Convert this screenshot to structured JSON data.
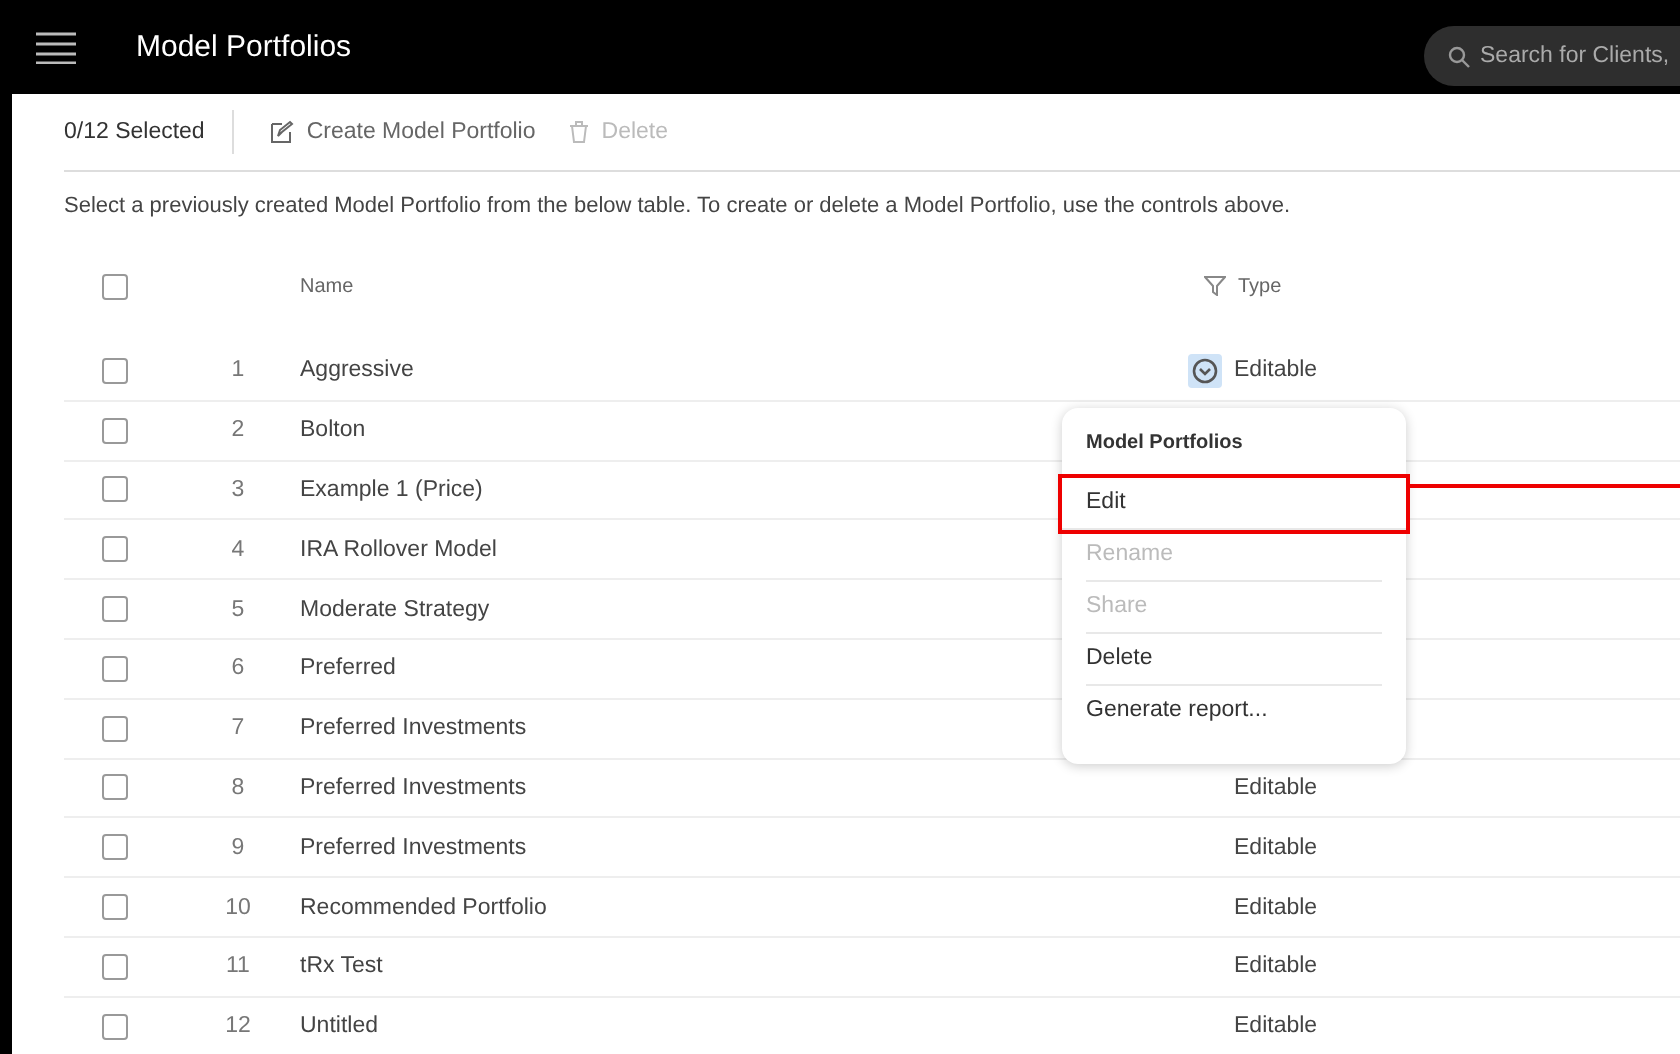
{
  "header": {
    "title": "Model Portfolios",
    "search": {
      "placeholder": "Search for Clients,"
    }
  },
  "toolbar": {
    "selection_count": "0/12 Selected",
    "actions": [
      {
        "label": "Create Model Portfolio",
        "disabled": false
      },
      {
        "label": "Delete",
        "disabled": true
      }
    ]
  },
  "description": "Select a previously created Model Portfolio from the below table. To create or delete a Model Portfolio, use the controls above.",
  "table": {
    "columns": [
      "Name",
      "Type"
    ],
    "all_checked": false,
    "rows": [
      {
        "number": "1",
        "name": "Aggressive",
        "type": "Editable",
        "checked": false,
        "menu_open": true
      },
      {
        "number": "2",
        "name": "Bolton",
        "checked": false
      },
      {
        "number": "3",
        "name": "Example 1 (Price)",
        "checked": false
      },
      {
        "number": "4",
        "name": "IRA Rollover Model",
        "checked": false
      },
      {
        "number": "5",
        "name": "Moderate Strategy",
        "checked": false
      },
      {
        "number": "6",
        "name": "Preferred",
        "checked": false
      },
      {
        "number": "7",
        "name": "Preferred Investments",
        "checked": false
      },
      {
        "number": "8",
        "name": "Preferred Investments",
        "type": "Editable",
        "checked": false,
        "menu_open": false
      },
      {
        "number": "9",
        "name": "Preferred Investments",
        "type": "Editable",
        "checked": false,
        "menu_open": false
      },
      {
        "number": "10",
        "name": "Recommended Portfolio",
        "type": "Editable",
        "checked": false,
        "menu_open": false
      },
      {
        "number": "11",
        "name": "tRx Test",
        "type": "Editable",
        "checked": false,
        "menu_open": false
      },
      {
        "number": "12",
        "name": "Untitled",
        "type": "Editable",
        "checked": false,
        "menu_open": false
      }
    ]
  },
  "context_menu": {
    "title": "Model Portfolios",
    "items": [
      {
        "label": "Edit",
        "disabled": false,
        "highlighted": true
      },
      {
        "label": "Rename",
        "disabled": true,
        "highlighted": false
      },
      {
        "label": "Share",
        "disabled": true,
        "highlighted": false
      },
      {
        "label": "Delete",
        "disabled": false,
        "highlighted": false
      },
      {
        "label": "Generate report...",
        "disabled": false,
        "highlighted": false
      }
    ]
  }
}
